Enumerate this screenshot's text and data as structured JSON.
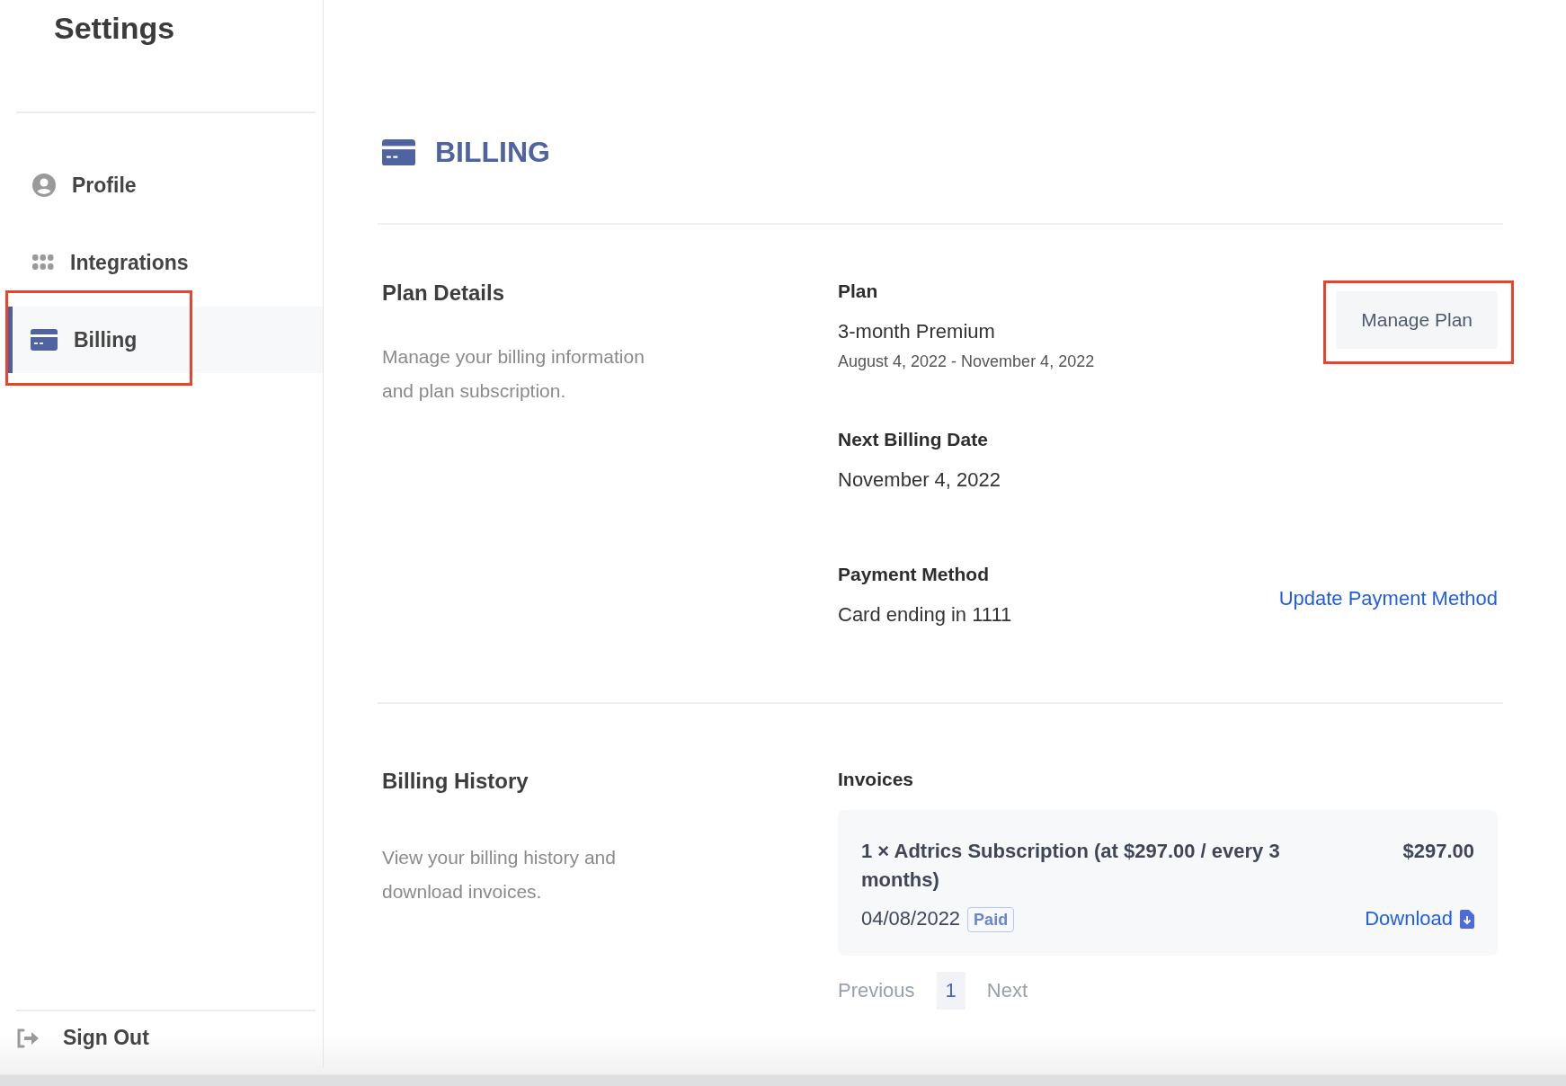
{
  "sidebar": {
    "title": "Settings",
    "items": [
      {
        "label": "Profile",
        "kind": "user",
        "selected": false,
        "annotated": false
      },
      {
        "label": "Integrations",
        "kind": "grid",
        "selected": false,
        "annotated": false
      },
      {
        "label": "Billing",
        "kind": "card",
        "selected": true,
        "annotated": true
      }
    ],
    "sign_out": "Sign Out"
  },
  "page": {
    "title": "BILLING"
  },
  "plan_details": {
    "heading": "Plan Details",
    "description": "Manage your billing information and plan subscription.",
    "plan_label": "Plan",
    "plan_name": "3-month Premium",
    "plan_period": "August 4, 2022 - November 4, 2022",
    "manage_button": {
      "label": "Manage Plan",
      "annotated": true
    },
    "next_billing_label": "Next Billing Date",
    "next_billing_date": "November 4, 2022",
    "payment_label": "Payment Method",
    "payment_value": "Card ending in 1111",
    "update_link": "Update Payment Method"
  },
  "billing_history": {
    "heading": "Billing History",
    "description": "View your billing history and download invoices.",
    "invoices_label": "Invoices",
    "invoices": [
      {
        "description": "1 × Adtrics Subscription (at $297.00 / every 3 months)",
        "amount": "$297.00",
        "date": "04/08/2022",
        "status": "Paid",
        "download": "Download"
      }
    ],
    "pagination": {
      "previous": "Previous",
      "pages": [
        {
          "label": "1",
          "selected": true
        }
      ],
      "next": "Next"
    }
  }
}
